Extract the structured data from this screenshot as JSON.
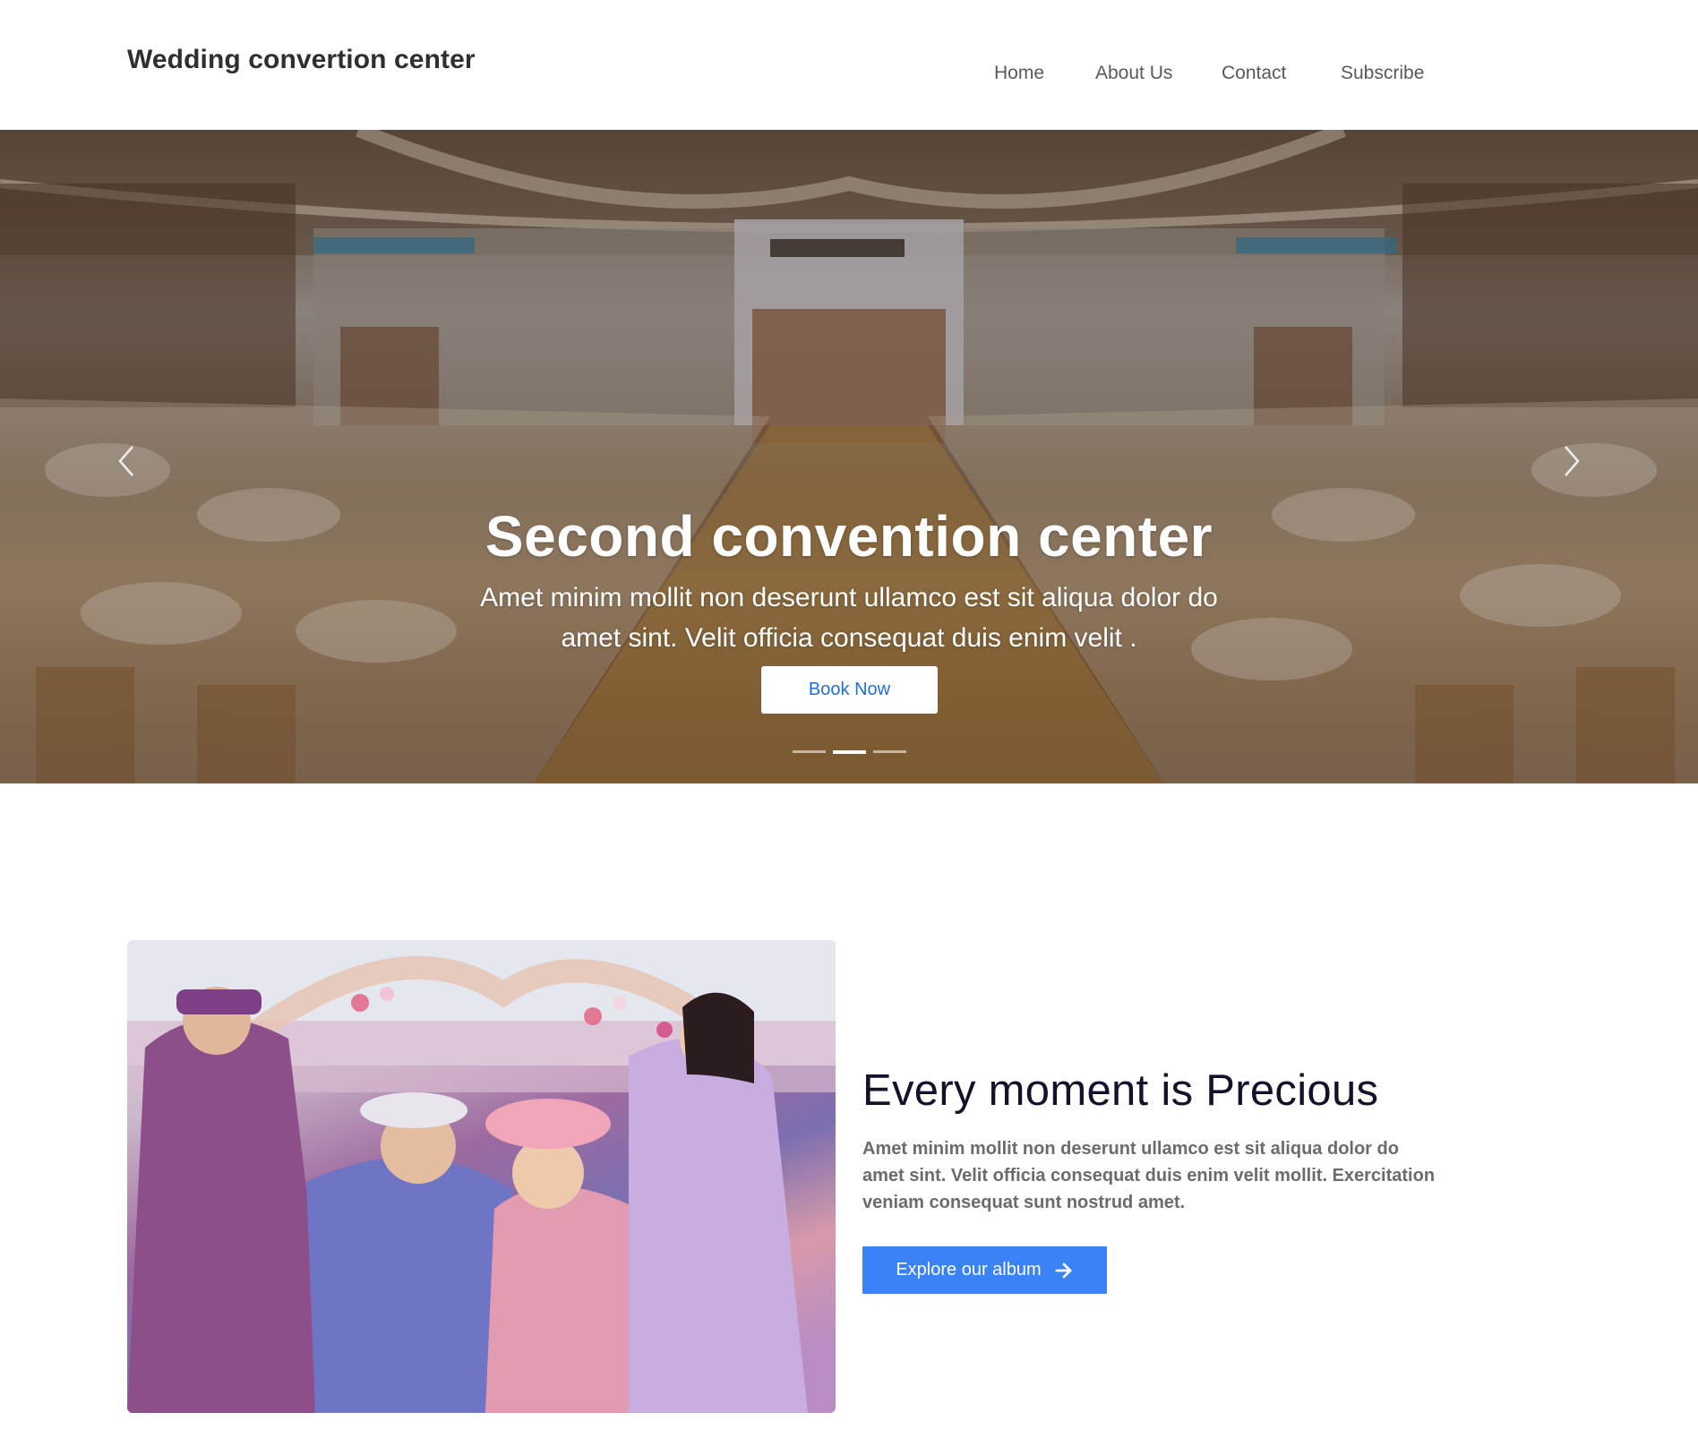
{
  "header": {
    "brand": "Wedding convertion center",
    "nav": [
      {
        "label": "Home"
      },
      {
        "label": "About Us"
      },
      {
        "label": "Contact"
      },
      {
        "label": "Subscribe"
      }
    ]
  },
  "hero": {
    "title": "Second convention center",
    "description": "Amet minim mollit non deserunt ullamco est sit aliqua dolor do amet sint. Velit officia consequat duis enim velit .",
    "button_label": "Book Now",
    "slide_count": 3,
    "active_slide": 2,
    "icons": {
      "prev": "chevron-left-icon",
      "next": "chevron-right-icon"
    }
  },
  "about": {
    "title": "Every moment is Precious",
    "text": "Amet minim mollit non deserunt ullamco est sit aliqua dolor do amet sint. Velit officia consequat duis enim velit mollit. Exercitation veniam consequat sunt nostrud amet.",
    "button_label": "Explore our album",
    "button_icon": "arrow-right-icon"
  },
  "colors": {
    "accent_blue": "#3b82f6",
    "book_button_text": "#1f6fd6",
    "heading_dark": "#14122b",
    "body_gray": "#6b6b6b"
  }
}
